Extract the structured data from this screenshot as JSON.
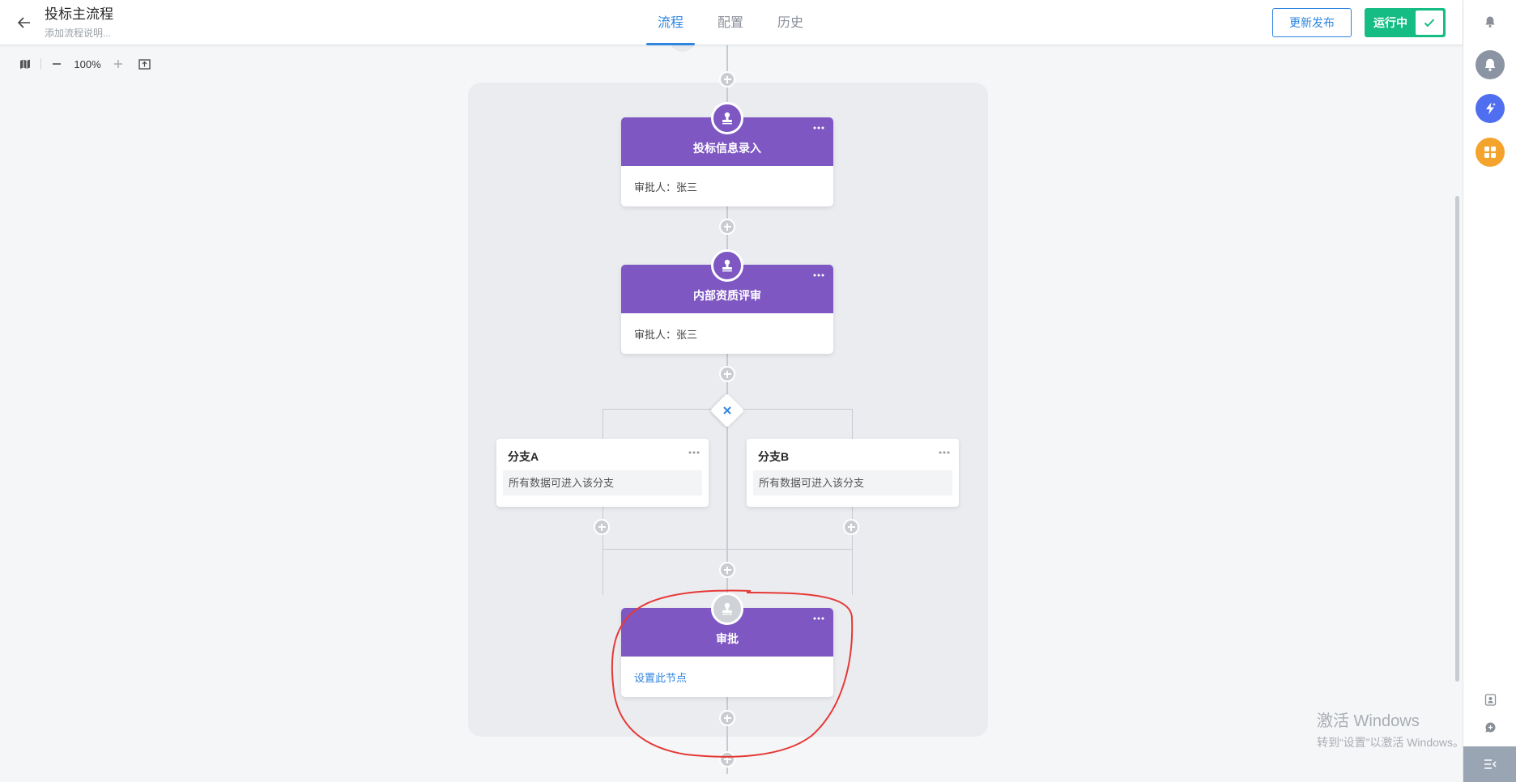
{
  "header": {
    "title": "投标主流程",
    "subtitle": "添加流程说明...",
    "tabs": [
      {
        "label": "流程",
        "active": true
      },
      {
        "label": "配置",
        "active": false
      },
      {
        "label": "历史",
        "active": false
      }
    ],
    "publish_label": "更新发布",
    "running_label": "运行中"
  },
  "toolbar": {
    "zoom": "100%"
  },
  "flow": {
    "nodes": [
      {
        "title": "投标信息录入",
        "body": "审批人：张三"
      },
      {
        "title": "内部资质评审",
        "body": "审批人：张三"
      },
      {
        "title": "审批",
        "body": "设置此节点"
      }
    ],
    "branches": [
      {
        "title": "分支A",
        "desc": "所有数据可进入该分支"
      },
      {
        "title": "分支B",
        "desc": "所有数据可进入该分支"
      }
    ]
  },
  "watermark": {
    "line1": "激活 Windows",
    "line2": "转到“设置”以激活 Windows。"
  },
  "colors": {
    "accent": "#2f85e0",
    "node_header": "#7e57c2",
    "running": "#15bc83",
    "highlight": "#e53935"
  }
}
